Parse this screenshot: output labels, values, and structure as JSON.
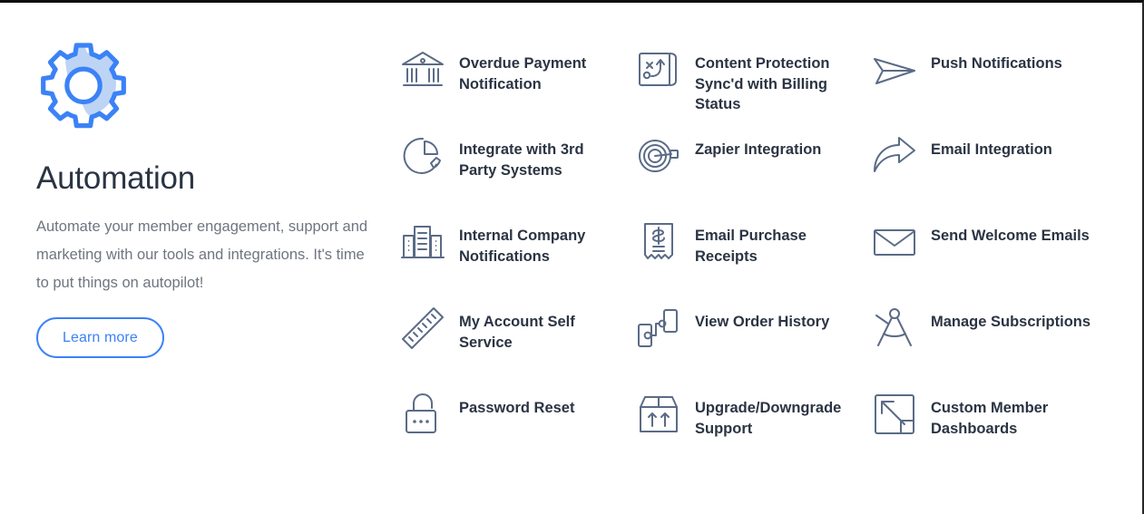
{
  "theme": {
    "accent_blue": "#3b82f6",
    "gear_fill": "#bed4f5",
    "icon_stroke": "#5b6b86",
    "heading_color": "#2b3443",
    "body_color": "#6f7580",
    "background": "#ffffff"
  },
  "intro": {
    "icon": "gear-icon",
    "title": "Automation",
    "description": "Automate your member engagement, support and marketing with our tools and integrations. It's time to put things on autopilot!",
    "button_label": "Learn more"
  },
  "features": [
    {
      "icon": "bank-icon",
      "label": "Overdue Payment Notification"
    },
    {
      "icon": "strategy-board-icon",
      "label": "Content Protection Sync'd with Billing Status"
    },
    {
      "icon": "paper-plane-icon",
      "label": "Push Notifications"
    },
    {
      "icon": "pie-chart-icon",
      "label": "Integrate with 3rd Party Systems"
    },
    {
      "icon": "target-arrow-icon",
      "label": "Zapier Integration"
    },
    {
      "icon": "curved-arrow-icon",
      "label": "Email Integration"
    },
    {
      "icon": "office-buildings-icon",
      "label": "Internal Company Notifications"
    },
    {
      "icon": "receipt-icon",
      "label": "Email Purchase Receipts"
    },
    {
      "icon": "envelope-icon",
      "label": "Send Welcome Emails"
    },
    {
      "icon": "ruler-icon",
      "label": "My Account Self Service"
    },
    {
      "icon": "flowchart-icon",
      "label": "View Order History"
    },
    {
      "icon": "compass-icon",
      "label": "Manage Subscriptions"
    },
    {
      "icon": "padlock-icon",
      "label": "Password Reset"
    },
    {
      "icon": "box-arrows-up-icon",
      "label": "Upgrade/Downgrade Support"
    },
    {
      "icon": "expand-arrow-icon",
      "label": "Custom Member Dashboards"
    }
  ]
}
